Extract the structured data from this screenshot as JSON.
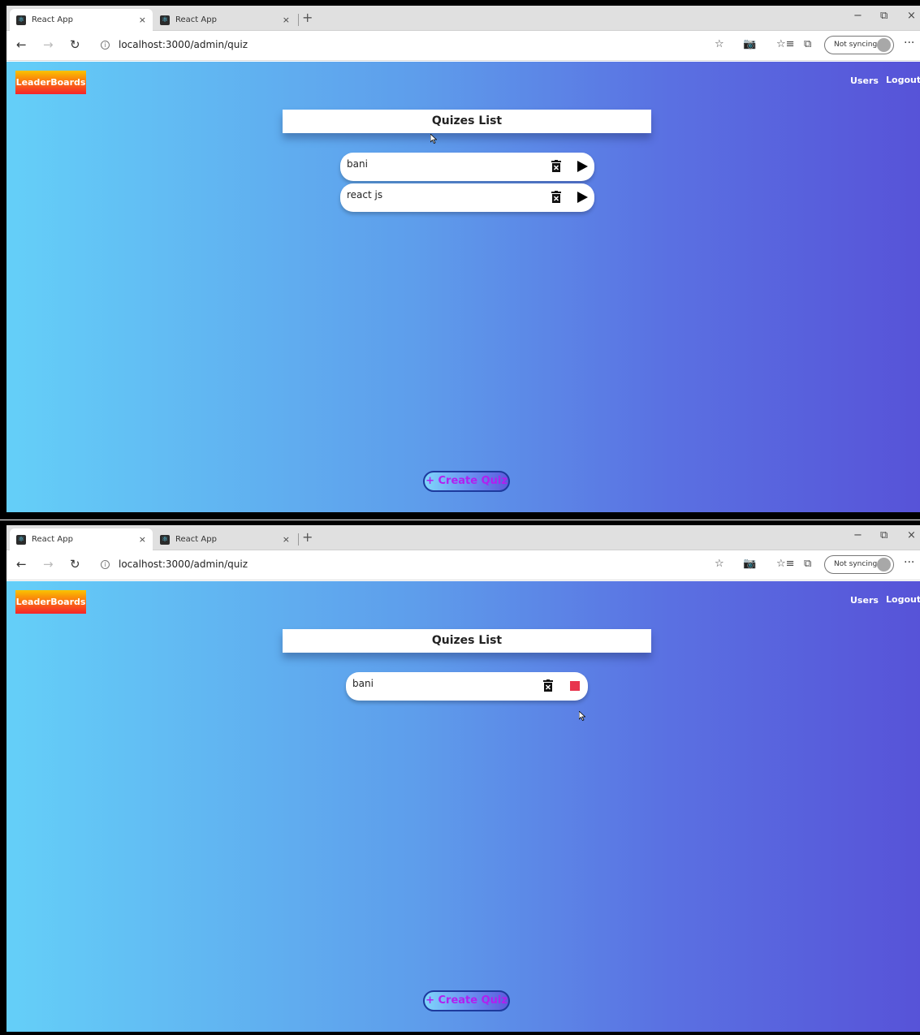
{
  "browser": {
    "tabs": [
      {
        "label": "React App",
        "close": "×"
      },
      {
        "label": "React App",
        "close": "×"
      }
    ],
    "new_tab": "+",
    "window_controls": {
      "minimize": "−",
      "restore": "⧉",
      "close": "×"
    },
    "nav": {
      "back": "←",
      "forward": "→",
      "refresh": "↻",
      "info": "i"
    },
    "url": "localhost:3000/admin/quiz",
    "toolbar": {
      "favorite": "☆",
      "camera": "📷",
      "favorites": "☆≡",
      "collections": "⧉"
    },
    "sync_label": "Not syncing",
    "more": "···"
  },
  "app": {
    "logo": "LeaderBoards",
    "nav_links": {
      "users": "Users",
      "logout": "Logout"
    },
    "title": "Quizes List",
    "create_button": "Create Quiz",
    "create_plus": "+"
  },
  "screens": [
    {
      "quizzes": [
        {
          "name": "bani",
          "state": "stopped"
        },
        {
          "name": "react js",
          "state": "stopped"
        }
      ]
    },
    {
      "quizzes": [
        {
          "name": "bani",
          "state": "running"
        }
      ]
    }
  ],
  "colors": {
    "stop_icon": "#e8354e",
    "create_text": "#b21ff0",
    "gradient_start": "#64cff8",
    "gradient_end": "#5753d8"
  }
}
